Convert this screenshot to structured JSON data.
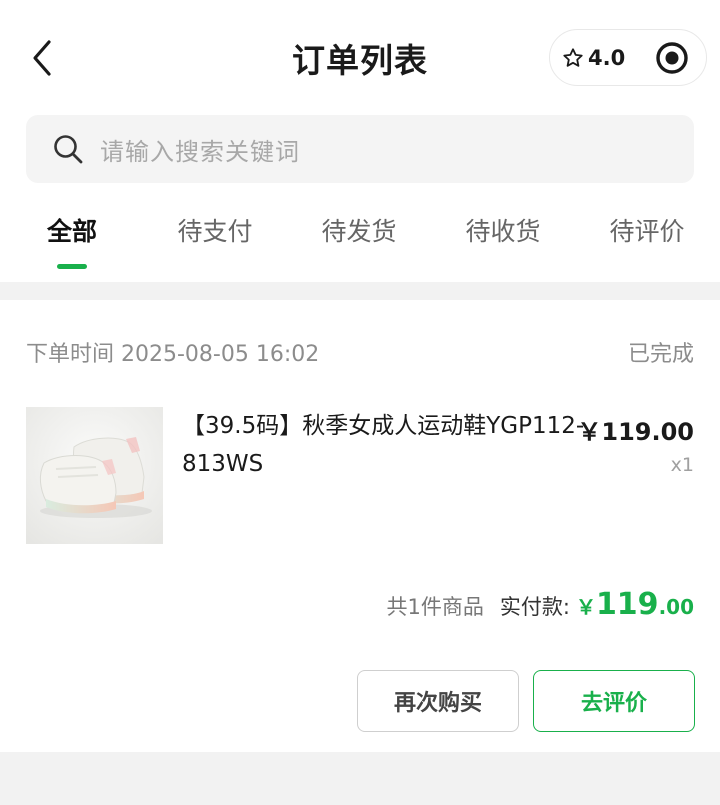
{
  "header": {
    "title": "订单列表",
    "back_icon": "chevron-left-icon",
    "rating": "4.0",
    "rating_icon": "star-outline-icon",
    "menu_icon": "target-icon"
  },
  "search": {
    "placeholder": "请输入搜索关键词",
    "icon": "search-icon"
  },
  "tabs": [
    {
      "label": "全部",
      "active": true
    },
    {
      "label": "待支付",
      "active": false
    },
    {
      "label": "待发货",
      "active": false
    },
    {
      "label": "待收货",
      "active": false
    },
    {
      "label": "待评价",
      "active": false
    }
  ],
  "order": {
    "time": "下单时间 2025-08-05 16:02",
    "status": "已完成",
    "product": {
      "name": "【39.5码】秋季女成人运动鞋YGP112-813WS",
      "price": "￥119.00",
      "qty": "x1"
    },
    "summary": {
      "count": "共1件商品",
      "paid_label": "实付款:",
      "currency": "￥",
      "amount_int": "119",
      "amount_dec": ".00"
    },
    "buttons": {
      "rebuy": "再次购买",
      "review": "去评价"
    }
  },
  "colors": {
    "accent": "#19b04b",
    "background": "#f2f2f2"
  }
}
